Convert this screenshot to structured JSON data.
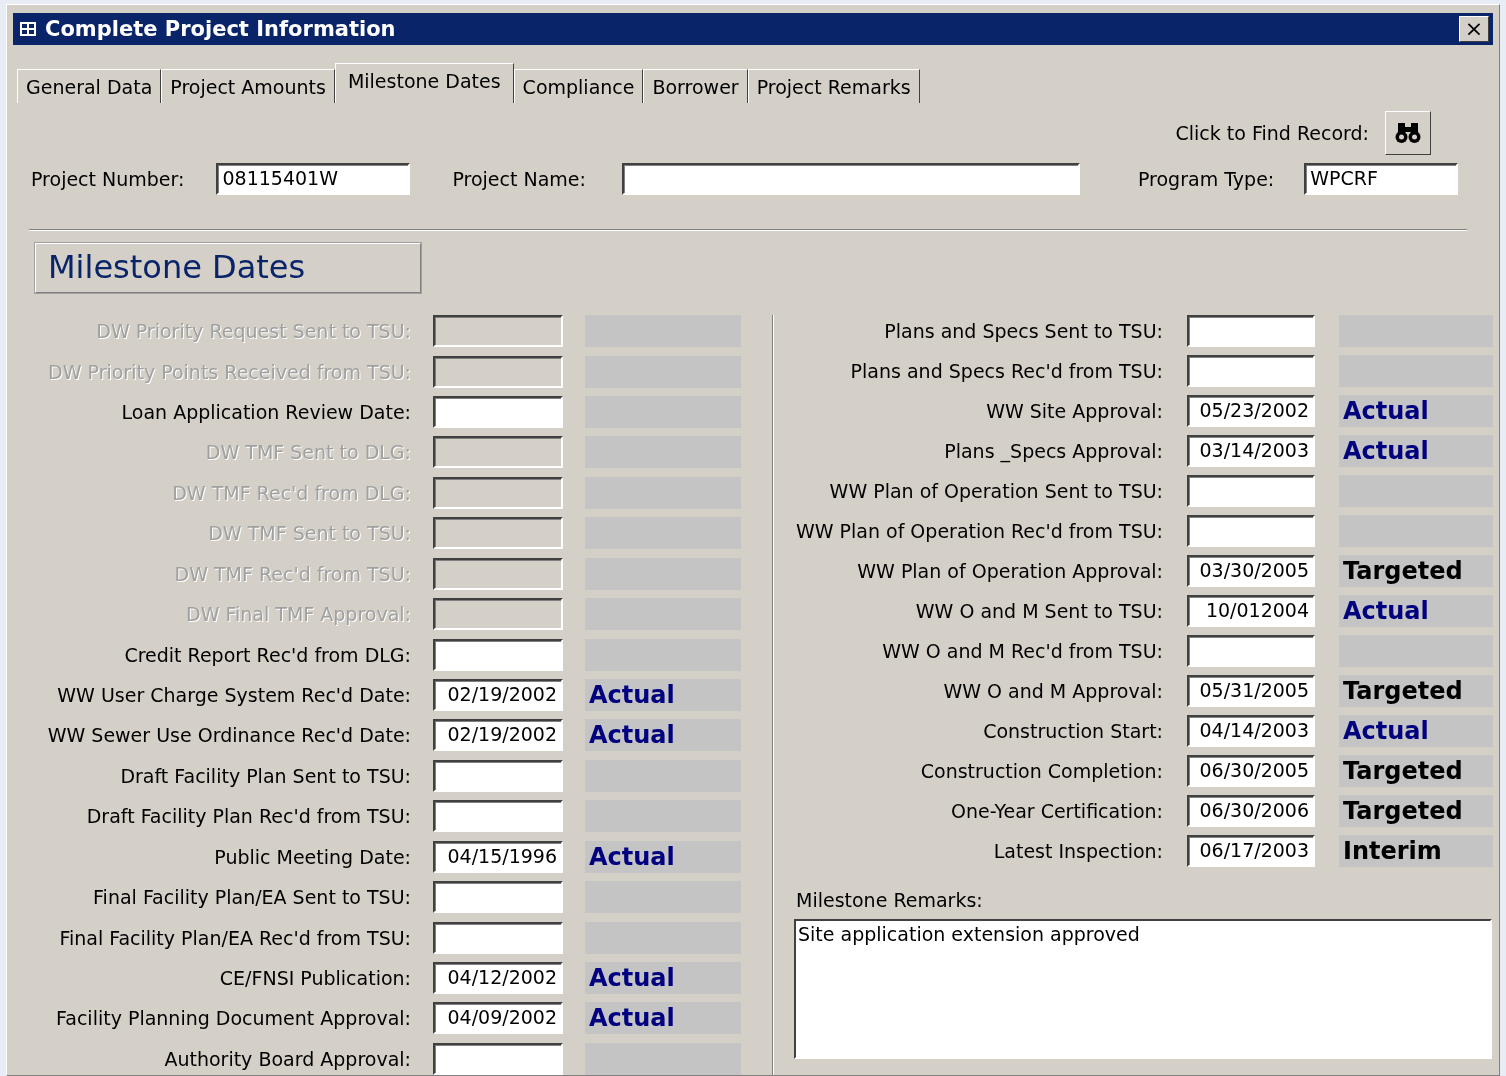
{
  "window": {
    "title": "Complete Project Information",
    "close": "×"
  },
  "tabs": [
    {
      "label": "General Data",
      "selected": false
    },
    {
      "label": "Project Amounts",
      "selected": false
    },
    {
      "label": "Milestone Dates",
      "selected": true
    },
    {
      "label": "Compliance",
      "selected": false
    },
    {
      "label": "Borrower",
      "selected": false
    },
    {
      "label": "Project Remarks",
      "selected": false
    }
  ],
  "find_record": {
    "label": "Click to Find Record:"
  },
  "header_fields": [
    {
      "label": "Project Number:",
      "value": "08115401W"
    },
    {
      "label": "Project Name:"
    },
    {
      "label": "Program Type:",
      "value": "WPCRF"
    }
  ],
  "section_title": "Milestone Dates",
  "left_milestones": [
    {
      "label": "DW Priority Request Sent to TSU:",
      "disabled": true
    },
    {
      "label": "DW Priority Points Received from TSU:",
      "disabled": true
    },
    {
      "label": "Loan Application Review Date:",
      "disabled": false
    },
    {
      "label": "DW TMF Sent to DLG:",
      "disabled": true
    },
    {
      "label": "DW TMF Rec'd from DLG:",
      "disabled": true
    },
    {
      "label": "DW TMF Sent to TSU:",
      "disabled": true
    },
    {
      "label": "DW TMF Rec'd from TSU:",
      "disabled": true
    },
    {
      "label": "DW Final TMF Approval:",
      "disabled": true
    },
    {
      "label": "Credit Report Rec'd from DLG:",
      "disabled": false
    },
    {
      "label": "WW User Charge System Rec'd Date:",
      "disabled": false,
      "date": "02/19/2002",
      "status": "Actual",
      "color": "#000080"
    },
    {
      "label": "WW Sewer Use Ordinance Rec'd Date:",
      "disabled": false,
      "date": "02/19/2002",
      "status": "Actual",
      "color": "#000080"
    },
    {
      "label": "Draft Facility Plan Sent to TSU:",
      "disabled": false
    },
    {
      "label": "Draft Facility Plan Rec'd from TSU:",
      "disabled": false
    },
    {
      "label": "Public Meeting Date:",
      "disabled": false,
      "date": "04/15/1996",
      "status": "Actual",
      "color": "#000080"
    },
    {
      "label": "Final Facility Plan/EA Sent to TSU:",
      "disabled": false
    },
    {
      "label": "Final Facility Plan/EA Rec'd from TSU:",
      "disabled": false
    },
    {
      "label": "CE/FNSI Publication:",
      "disabled": false,
      "date": "04/12/2002",
      "status": "Actual",
      "color": "#000080"
    },
    {
      "label": "Facility Planning Document Approval:",
      "disabled": false,
      "date": "04/09/2002",
      "status": "Actual",
      "color": "#000080"
    },
    {
      "label": "Authority Board Approval:",
      "disabled": false
    }
  ],
  "right_milestones": [
    {
      "label": "Plans and Specs Sent to TSU:"
    },
    {
      "label": "Plans and Specs Rec'd from TSU:"
    },
    {
      "label": "WW Site Approval:",
      "date": "05/23/2002",
      "status": "Actual",
      "color": "#000080"
    },
    {
      "label": "Plans _Specs Approval:",
      "date": "03/14/2003",
      "status": "Actual",
      "color": "#000080"
    },
    {
      "label": "WW Plan of Operation Sent to TSU:"
    },
    {
      "label": "WW Plan of Operation Rec'd from TSU:"
    },
    {
      "label": "WW Plan of Operation Approval:",
      "date": "03/30/2005",
      "status": "Targeted",
      "color": "#000000"
    },
    {
      "label": "WW O and M Sent to TSU:",
      "date": "10/012004",
      "status": "Actual",
      "color": "#000080"
    },
    {
      "label": "WW O and M Rec'd from TSU:"
    },
    {
      "label": "WW O and M Approval:",
      "date": "05/31/2005",
      "status": "Targeted",
      "color": "#000000"
    },
    {
      "label": "Construction Start:",
      "date": "04/14/2003",
      "status": "Actual",
      "color": "#000080"
    },
    {
      "label": "Construction Completion:",
      "date": "06/30/2005",
      "status": "Targeted",
      "color": "#000000"
    },
    {
      "label": "One-Year Certification:",
      "date": "06/30/2006",
      "status": "Targeted",
      "color": "#000000"
    },
    {
      "label": "Latest Inspection:",
      "date": "06/17/2003",
      "status": "Interim",
      "color": "#000000"
    }
  ],
  "remarks": {
    "label": "Milestone Remarks:",
    "value": "Site application extension approved"
  }
}
